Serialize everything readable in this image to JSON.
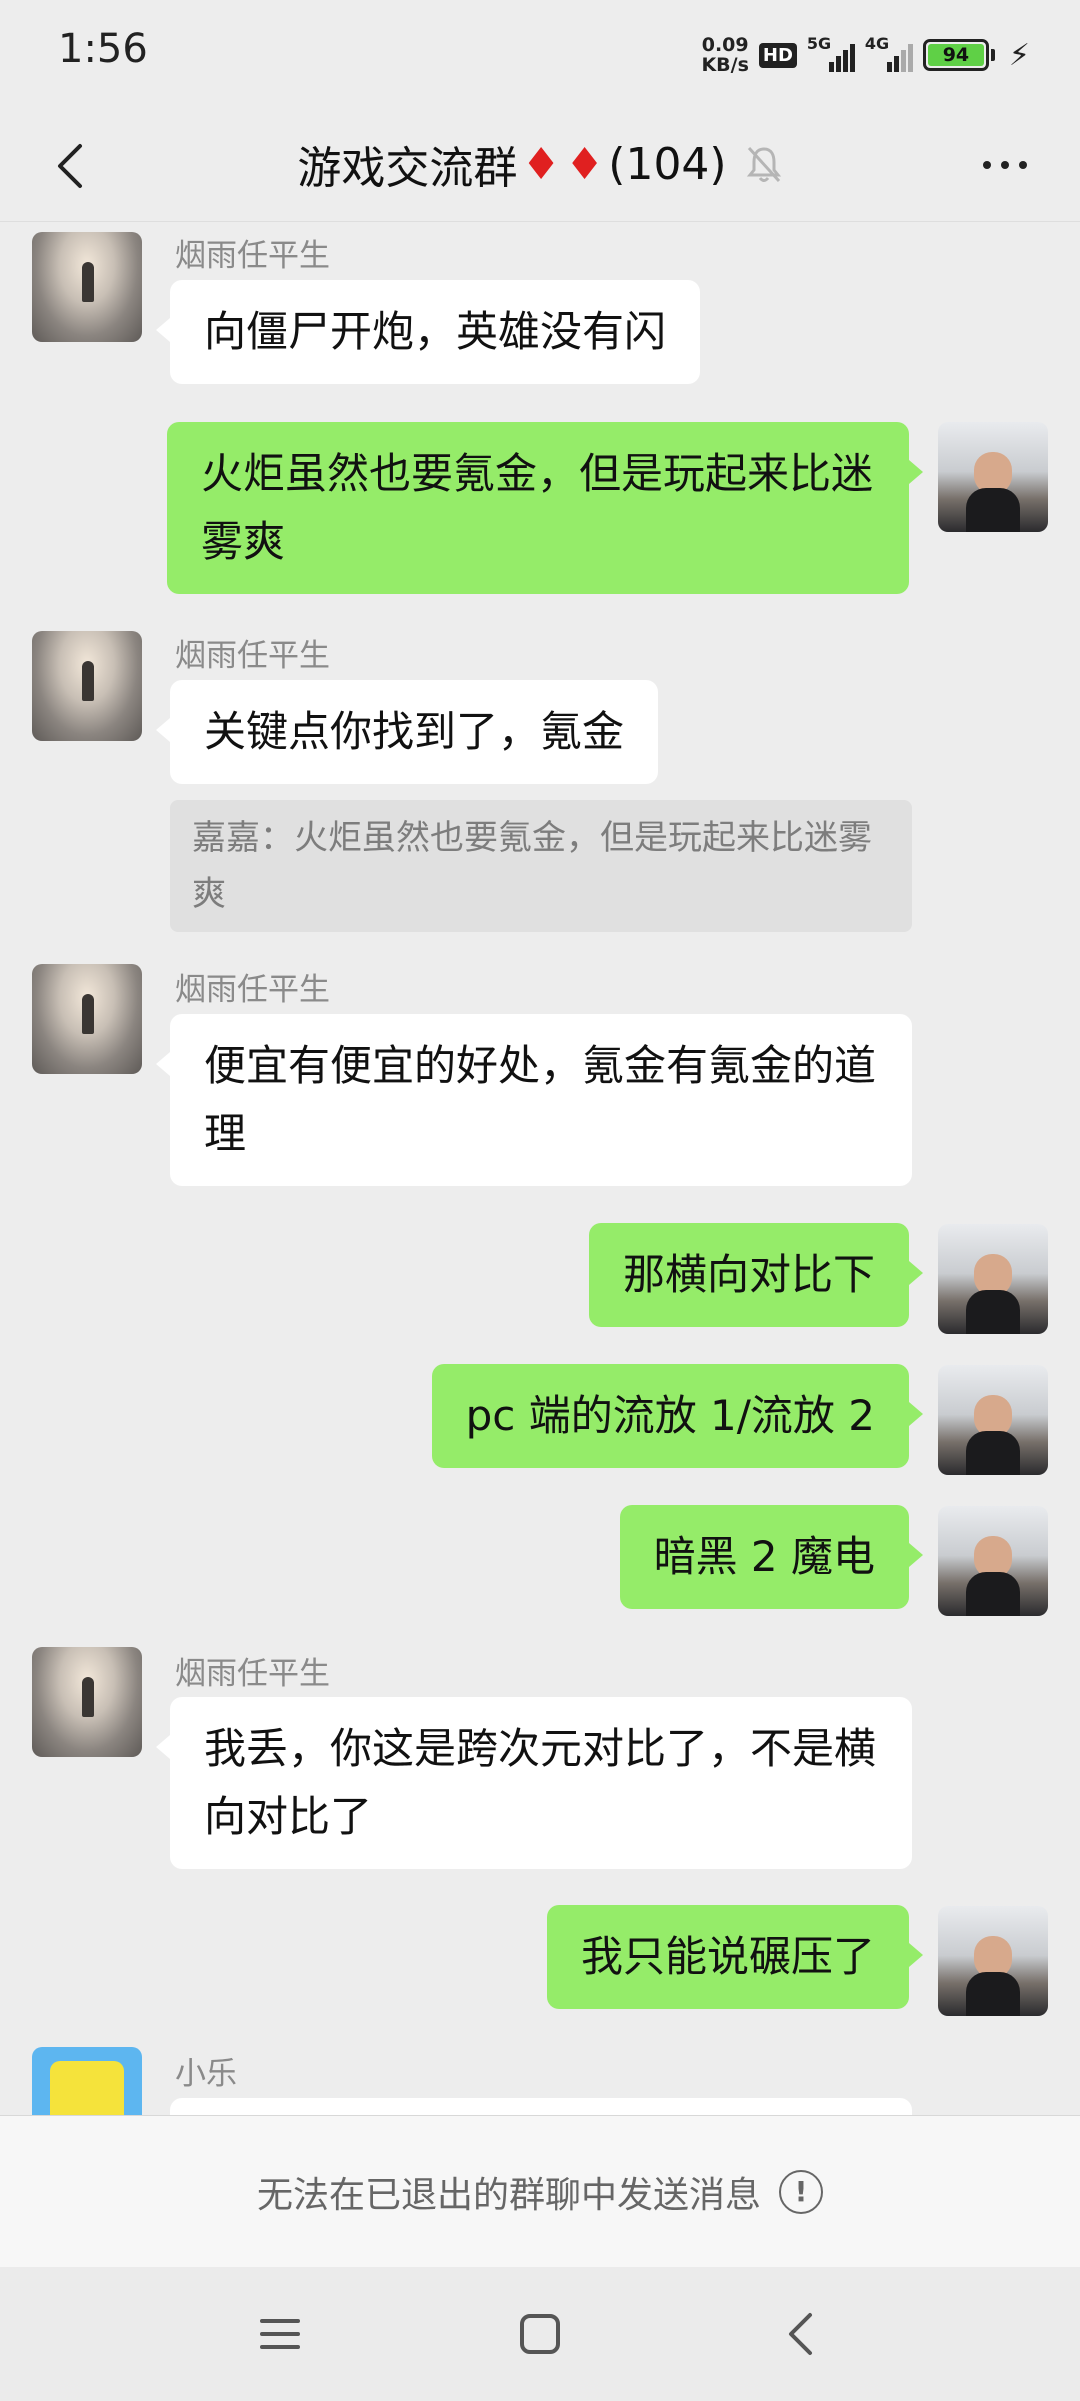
{
  "status": {
    "time": "1:56",
    "net_speed_value": "0.09",
    "net_speed_unit": "KB/s",
    "hd_label": "HD",
    "signal1_label": "5G",
    "signal2_label": "4G",
    "battery": "94"
  },
  "header": {
    "title_prefix": "游戏交流群",
    "diamond1": "♦",
    "diamond2": "♦",
    "member_count": "(104)"
  },
  "messages": [
    {
      "sender": "烟雨任平生",
      "text": "向僵尸开炮，英雄没有闪"
    },
    {
      "text": "火炬虽然也要氪金，但是玩起来比迷雾爽"
    },
    {
      "sender": "烟雨任平生",
      "text": "关键点你找到了，氪金"
    },
    {
      "quote": "嘉嘉：火炬虽然也要氪金，但是玩起来比迷雾爽"
    },
    {
      "sender": "烟雨任平生",
      "text": "便宜有便宜的好处，氪金有氪金的道理"
    },
    {
      "text": "那横向对比下"
    },
    {
      "text": "pc 端的流放 1/流放 2"
    },
    {
      "text": "暗黑 2 魔电"
    },
    {
      "sender": "烟雨任平生",
      "text": "我丢，你这是跨次元对比了，不是横向对比了"
    },
    {
      "text": "我只能说碾压了"
    },
    {
      "sender": "小乐"
    }
  ],
  "input_bar": {
    "disabled_text": "无法在已退出的群聊中发送消息",
    "info_symbol": "!"
  },
  "colors": {
    "my_bubble": "#95ec69",
    "other_bubble": "#ffffff",
    "background": "#ededed",
    "diamond": "#e02020"
  }
}
